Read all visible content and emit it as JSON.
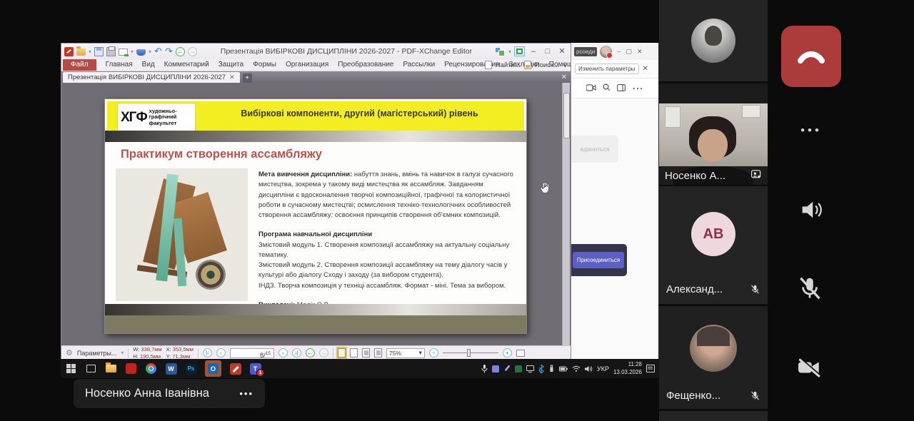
{
  "window": {
    "title": "Презентація ВИБІРКОВІ ДИСЦИПЛІНИ 2026-2027 - PDF-XChange Editor",
    "tab_title": "Презентація ВИБІРКОВІ ДИСЦИПЛІНИ 2026-2027",
    "menus": [
      "Файл",
      "Главная",
      "Вид",
      "Комментарий",
      "Защита",
      "Формы",
      "Организация",
      "Преобразование",
      "Рассылки",
      "Рецензирование",
      "Закладки",
      "Помощь"
    ],
    "find_label": "Найти...",
    "search_label": "Поиск..."
  },
  "slide": {
    "logo_abbr": "ХГФ",
    "logo_line1": "художньо-",
    "logo_line2": "графічний",
    "logo_line3": "факультет",
    "header_title": "Вибіркові компоненти, другий (магістерський) рівень",
    "title": "Практикум створення ассамбляжу",
    "goal_label": "Мета вивчення дисципліни:",
    "goal_text": " набуття знань, вмінь та навичок в галузі сучасного мистецтва, зокрема у такому виді мистецтва як ассамбляж. Завданням дисципліни є вдосконалення творчої композиційної, графічної та колористичної роботи в сучасному мистецтві; осмислення техніко-технологічних особливостей створення ассамбляжу; освоєння принципів створення об’ємних композицій.",
    "program_label": "Програма навчальної дисципліни",
    "module1": "Змістовий модуль 1. Створення композиції ассамбляжу на актуальну соціальну тематику.",
    "module2": "Змістовий модуль 2. Створення композиції ассамбляжу на тему діалогу часів у культурі або діалогу Сходу і заходу (за вибором студента).",
    "indz": "ІНДЗ. Творча композиція у техніці ассамбляж. Формат - міні. Тема за вибором.",
    "teachers_label": "Викладачі:",
    "teachers_value": " Малік О.В."
  },
  "statusbar": {
    "params_label": "Параметры...",
    "w_label": "W:",
    "w_value": "338,7мм",
    "h_label": "H:",
    "h_value": "190,5мм",
    "x_label": "X:",
    "x_value": "353,5мм",
    "y_label": "Y:",
    "y_value": "71,3мм",
    "page_current": "8",
    "page_separator": "/",
    "page_total": "15",
    "zoom_value": "75%"
  },
  "join_panel": {
    "partial_title": "рсоеди",
    "change_settings": "Изменить параметры",
    "disabled_button": "единиться",
    "join_button": "Присоединиться"
  },
  "taskbar": {
    "lang": "УКР",
    "time": "11:28",
    "date": "13.03.2026",
    "teams_badge": "1",
    "icon_glyphs": {
      "word": "W",
      "photoshop": "Ps",
      "outlook": "O",
      "teams": "T"
    }
  },
  "call": {
    "name_plate": "Носенко Анна Іванівна",
    "name_plate_more": "•••",
    "more_dots": "•••",
    "participants": [
      {
        "label": "Носенко А..."
      },
      {
        "label": "Александ...",
        "initials": "АВ"
      },
      {
        "label": "Фещенко..."
      }
    ]
  },
  "colors": {
    "hangup_button": "#ac3c3c",
    "join_button": "#5b5fc7",
    "slide_banner_yellow": "#f2ee21",
    "slide_title_red": "#b9544d",
    "file_menu_red": "#b64a45"
  }
}
